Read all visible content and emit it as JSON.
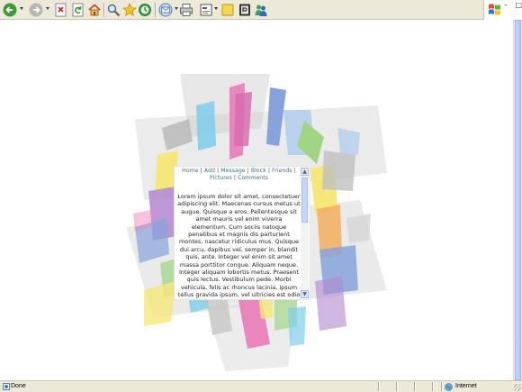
{
  "toolbar": {
    "buttons": [
      {
        "name": "back-button",
        "icon": "back-arrow-icon",
        "color": "#3d9b35",
        "has_dropdown": true
      },
      {
        "name": "forward-button",
        "icon": "forward-arrow-icon",
        "color": "#9e9e9e",
        "has_dropdown": true
      },
      {
        "name": "stop-button",
        "icon": "stop-icon",
        "color": "#cf2d25"
      },
      {
        "name": "refresh-button",
        "icon": "refresh-icon",
        "color": "#2f7fd0"
      },
      {
        "name": "home-button",
        "icon": "home-icon",
        "color": "#d47a25"
      },
      {
        "name": "search-button",
        "icon": "search-icon",
        "color": "#5a6fa8"
      },
      {
        "name": "favorites-button",
        "icon": "favorites-star-icon",
        "color": "#f2c316"
      },
      {
        "name": "history-button",
        "icon": "history-icon",
        "color": "#2e8a3a"
      },
      {
        "name": "mail-button",
        "icon": "mail-icon",
        "color": "#5a7fb5",
        "has_dropdown": true
      },
      {
        "name": "print-button",
        "icon": "printer-icon",
        "color": "#6f6f6f"
      },
      {
        "name": "edit-button",
        "icon": "edit-document-icon",
        "color": "#6f6f6f",
        "has_dropdown": true
      },
      {
        "name": "discuss-button",
        "icon": "notes-icon",
        "color": "#f4d24a"
      },
      {
        "name": "research-button",
        "icon": "research-icon",
        "color": "#444444"
      },
      {
        "name": "messenger-button",
        "icon": "messenger-icon",
        "color": "#4a9a7a"
      }
    ],
    "window_controls": "– □ ×"
  },
  "content": {
    "nav": [
      {
        "label": "Home"
      },
      {
        "label": "Add"
      },
      {
        "label": "Message"
      },
      {
        "label": "Block"
      },
      {
        "label": "Friends"
      },
      {
        "label": "Pictures"
      },
      {
        "label": "Comments"
      }
    ],
    "nav_separator": "|",
    "body_text": "Lorem ipsum dolor sit amet, consectetuer adipiscing elit. Maecenas cursus metus ut augue. Quisque a eros. Pellentesque sit amet mauris vel enim viverra elementum. Cum sociis natoque penatibus et magnis dis parturient montes, nascetur ridiculus mus. Quisque dui arcu, dapibus vel, semper in, blandit quis, ante. Integer vel enim sit amet massa porttitor congue. Aliquam neque. Integer aliquam lobortis metus. Praesent quis lectus. Vestibulum pede. Morbi vehicula, felis ac rhoncus lacinia, ipsum tellus gravida ipsum, vel ultricies est odio ac magna. In metus diam, fermentum eget, bibendum condimentum, semper",
    "scroll_up": "▲",
    "scroll_down": "▼"
  },
  "status": {
    "text": "Done",
    "zone": "Internet"
  },
  "colors": {
    "toolbar_bg": "#ece9d8",
    "link": "#3e6f8f",
    "paint_pink": "#e879b8",
    "paint_blue": "#7a9ad8",
    "paint_yellow": "#f6e66a",
    "paint_green": "#97d17a",
    "paint_purple": "#a879c9",
    "paint_gray": "#b9b9b9",
    "paint_cyan": "#6fc9e8",
    "paint_orange": "#f2a64b"
  }
}
